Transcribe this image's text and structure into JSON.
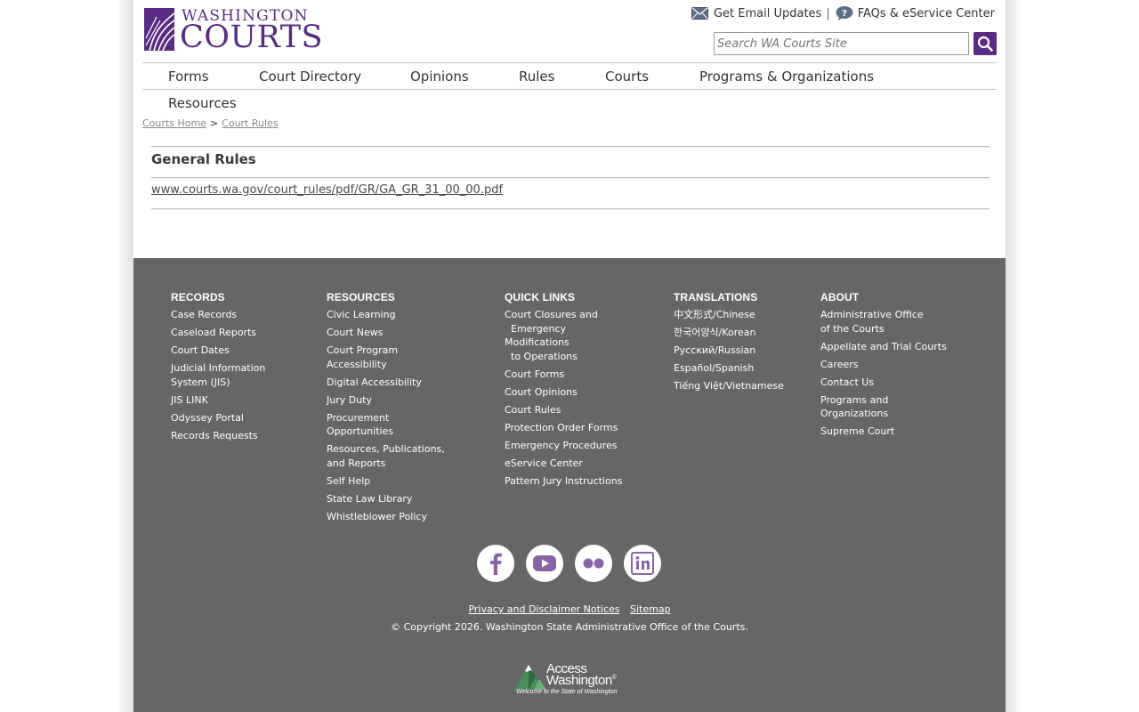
{
  "header": {
    "logo_top": "WASHINGTON",
    "logo_bottom": "COURTS",
    "email_updates": "Get Email Updates",
    "separator": "|",
    "faqs": "FAQs & eService Center",
    "search_placeholder": "Search WA Courts Site"
  },
  "nav": {
    "forms": "Forms",
    "court_directory": "Court Directory",
    "opinions": "Opinions",
    "rules": "Rules",
    "courts": "Courts",
    "programs": "Programs & Organizations",
    "resources": "Resources"
  },
  "breadcrumb": {
    "home": "Courts Home",
    "sep": ">",
    "current": "Court Rules"
  },
  "content": {
    "title": "General Rules",
    "link": "www.courts.wa.gov/court_rules/pdf/GR/GA_GR_31_00_00.pdf"
  },
  "footer": {
    "records": {
      "heading": "RECORDS",
      "items": [
        "Case Records",
        "Caseload Reports",
        "Court Dates",
        "Judicial Information\nSystem (JIS)",
        "JIS LINK",
        "Odyssey Portal",
        "Records Requests"
      ]
    },
    "resources": {
      "heading": "RESOURCES",
      "items": [
        "Civic Learning",
        "Court News",
        "Court Program\nAccessibility",
        "Digital Accessibility",
        "Jury Duty",
        "Procurement\nOpportunities",
        "Resources, Publications,\nand Reports",
        "Self Help",
        "State Law Library",
        "Whistleblower Policy"
      ]
    },
    "quick_links": {
      "heading": "QUICK LINKS",
      "items": [
        "Court Closures and\n  Emergency\nModifications\n  to Operations",
        "Court Forms",
        "Court Opinions",
        "Court Rules",
        "Protection Order Forms",
        "Emergency Procedures",
        "eService Center",
        "Pattern Jury Instructions"
      ]
    },
    "translations": {
      "heading": "TRANSLATIONS",
      "items": [
        "中文形式/Chinese",
        "한국어양식/Korean",
        "Русский/Russian",
        "Español/Spanish",
        "Tiếng Việt/Vietnamese"
      ]
    },
    "about": {
      "heading": "ABOUT",
      "items": [
        "Administrative Office\nof the Courts",
        "Appellate and Trial Courts",
        "Careers",
        "Contact Us",
        "Programs and\nOrganizations",
        "Supreme Court"
      ]
    },
    "social_icons": [
      "facebook-icon",
      "youtube-icon",
      "flickr-icon",
      "linkedin-icon"
    ],
    "privacy": "Privacy and Disclaimer Notices",
    "sitemap": "Sitemap",
    "copyright": "© Copyright 2026. Washington State Administrative Office of the Courts.",
    "access_line1": "Access",
    "access_line2": "Washington",
    "access_reg": "®",
    "access_tagline": "Welcome to the State of Washington"
  },
  "colors": {
    "brand_purple": "#582c83",
    "footer_gray": "#666666",
    "icon_purple": "#8a64a6"
  }
}
